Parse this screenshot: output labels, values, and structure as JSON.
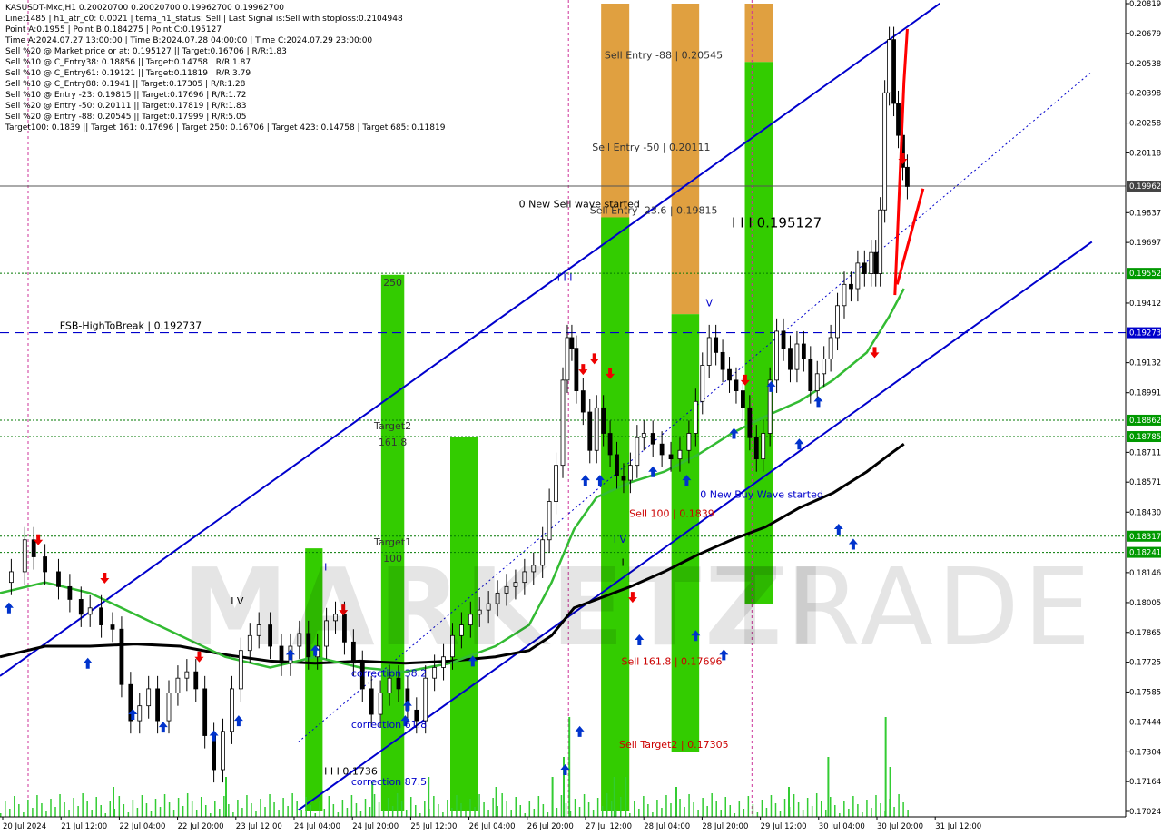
{
  "header": {
    "lines": [
      "KASUSDT-Mxc,H1  0.20020700 0.20020700 0.19962700 0.19962700",
      "Line:1485 | h1_atr_c0: 0.0021 | tema_h1_status: Sell | Last Signal is:Sell with stoploss:0.2104948",
      "Point A:0.1955 | Point B:0.184275 | Point C:0.195127",
      "Time A:2024.07.27 13:00:00 | Time B:2024.07.28 04:00:00 | Time C:2024.07.29 23:00:00",
      "Sell %20 @ Market price or at: 0.195127 || Target:0.16706 | R/R:1.83",
      "Sell %10 @ C_Entry38: 0.18856 || Target:0.14758 | R/R:1.87",
      "Sell %10 @ C_Entry61: 0.19121 || Target:0.11819 | R/R:3.79",
      "Sell %10 @ C_Entry88: 0.1941 || Target:0.17305 | R/R:1.28",
      "Sell %10 @ Entry -23: 0.19815 || Target:0.17696 | R/R:1.72",
      "Sell %20 @ Entry -50: 0.20111 || Target:0.17819 | R/R:1.83",
      "Sell %20 @ Entry -88: 0.20545 || Target:0.17999 | R/R:5.05",
      "Target100: 0.1839 || Target 161: 0.17696 | Target 250: 0.16706 | Target 423: 0.14758 | Target 685: 0.11819"
    ]
  },
  "watermark": {
    "left": "MARKETZI",
    "right": "TRADE"
  },
  "colors": {
    "channel": "#0000cc",
    "green_bar": "#33cc00",
    "orange_bar": "#e0a040",
    "ma_green": "#33bb33",
    "ma_black": "#000000",
    "grid_level": "#007700",
    "red": "#ff0000",
    "price_tag": "#444444"
  },
  "chart_data": {
    "type": "line",
    "symbol": "KASUSDT-Mxc",
    "timeframe": "H1",
    "ylim": [
      0.17024,
      0.20819
    ],
    "y_ticks": [
      "0.20819",
      "0.20679",
      "0.20538",
      "0.20398",
      "0.20258",
      "0.20118",
      "0.19837",
      "0.19697",
      "0.19412",
      "0.19132",
      "0.18991",
      "0.18711",
      "0.18571",
      "0.18430",
      "0.18146",
      "0.18005",
      "0.17865",
      "0.17725",
      "0.17585",
      "0.17444",
      "0.17304",
      "0.17164",
      "0.17024"
    ],
    "x_labels": [
      "20 Jul 2024",
      "21 Jul 12:00",
      "22 Jul 04:00",
      "22 Jul 20:00",
      "23 Jul 12:00",
      "24 Jul 04:00",
      "24 Jul 20:00",
      "25 Jul 12:00",
      "26 Jul 04:00",
      "26 Jul 20:00",
      "27 Jul 12:00",
      "28 Jul 04:00",
      "28 Jul 20:00",
      "29 Jul 12:00",
      "30 Jul 04:00",
      "30 Jul 20:00",
      "31 Jul 12:00"
    ],
    "price_tags": [
      {
        "value": 0.19962,
        "label": "0.19962",
        "kind": "current"
      },
      {
        "value": 0.19552,
        "label": "0.19552",
        "kind": "level"
      },
      {
        "value": 0.19273,
        "label": "0.19273",
        "kind": "fsb"
      },
      {
        "value": 0.18862,
        "label": "0.18862",
        "kind": "level"
      },
      {
        "value": 0.18785,
        "label": "0.18785",
        "kind": "level"
      },
      {
        "value": 0.18317,
        "label": "0.18317",
        "kind": "level"
      },
      {
        "value": 0.18241,
        "label": "0.18241",
        "kind": "level"
      }
    ],
    "bars": [
      {
        "color": "green",
        "x0": 0.3386,
        "x1": 0.3591,
        "top": 0.19545,
        "bottom": 0.17024,
        "label_top": "250",
        "label_mid": "Target2",
        "label_mid2": "161.8",
        "label_low": "Target1",
        "label_low2": "100"
      },
      {
        "color": "green",
        "x0": 0.2711,
        "x1": 0.2866,
        "top": 0.1826,
        "bottom": 0.17024
      },
      {
        "color": "green",
        "x0": 0.4,
        "x1": 0.4246,
        "top": 0.18785,
        "bottom": 0.17024
      },
      {
        "color": "orange",
        "x0": 0.534,
        "x1": 0.559,
        "top": 0.20819,
        "bottom": 0.17024
      },
      {
        "color": "green",
        "x0": 0.534,
        "x1": 0.559,
        "top": 0.19815,
        "bottom": 0.17024
      },
      {
        "color": "orange",
        "x0": 0.5965,
        "x1": 0.6211,
        "top": 0.20819,
        "bottom": 0.1936
      },
      {
        "color": "green",
        "x0": 0.5965,
        "x1": 0.6211,
        "top": 0.1936,
        "bottom": 0.17305
      },
      {
        "color": "orange",
        "x0": 0.6617,
        "x1": 0.6865,
        "top": 0.20819,
        "bottom": 0.20545
      },
      {
        "color": "green",
        "x0": 0.6617,
        "x1": 0.6865,
        "top": 0.20545,
        "bottom": 0.18
      }
    ],
    "labels": [
      {
        "text": "Sell Entry -88 | 0.20545",
        "x": 0.537,
        "y": 0.20545,
        "color": "#333333"
      },
      {
        "text": "Sell Entry -50 | 0.20111",
        "x": 0.526,
        "y": 0.20111,
        "color": "#333333"
      },
      {
        "text": "Sell Entry -23.6 | 0.19815",
        "x": 0.524,
        "y": 0.19815,
        "color": "#333333"
      },
      {
        "text": "0 New Sell wave started",
        "x": 0.461,
        "y": 0.19815,
        "color": "#000000",
        "dy": -7
      },
      {
        "text": "I I I 0.195127",
        "x": 0.65,
        "y": 0.1975,
        "color": "#000000"
      },
      {
        "text": "FSB-HighToBreak | 0.192737",
        "x": 0.053,
        "y": 0.19273,
        "color": "#000000"
      },
      {
        "text": "Sell 100 | 0.1839",
        "x": 0.559,
        "y": 0.1839,
        "color": "#cc0000"
      },
      {
        "text": "0 New Buy Wave started",
        "x": 0.622,
        "y": 0.1848,
        "color": "#0000cc"
      },
      {
        "text": "Sell 161.8 | 0.17696",
        "x": 0.552,
        "y": 0.17696,
        "color": "#cc0000"
      },
      {
        "text": "Sell Target2 | 0.17305",
        "x": 0.55,
        "y": 0.17305,
        "color": "#cc0000"
      },
      {
        "text": "correction 38.2",
        "x": 0.312,
        "y": 0.1764,
        "color": "#0000cc"
      },
      {
        "text": "correction 61.8",
        "x": 0.312,
        "y": 0.174,
        "color": "#0000cc"
      },
      {
        "text": "correction 87.5",
        "x": 0.312,
        "y": 0.1713,
        "color": "#0000cc"
      },
      {
        "text": "I I I 0.1736",
        "x": 0.288,
        "y": 0.1718,
        "color": "#000000"
      },
      {
        "text": "I I I",
        "x": 0.495,
        "y": 0.195,
        "color": "#0000cc"
      },
      {
        "text": "V",
        "x": 0.627,
        "y": 0.1938,
        "color": "#0000cc"
      },
      {
        "text": "I V",
        "x": 0.205,
        "y": 0.1798,
        "color": "#000000"
      },
      {
        "text": "I V",
        "x": 0.545,
        "y": 0.1827,
        "color": "#0000cc"
      },
      {
        "text": "I",
        "x": 0.288,
        "y": 0.1814,
        "color": "#0000cc"
      },
      {
        "text": "I",
        "x": 0.552,
        "y": 0.1816,
        "color": "#000000"
      }
    ],
    "price_series": [
      [
        0.0,
        0.181
      ],
      [
        0.01,
        0.1815
      ],
      [
        0.022,
        0.183
      ],
      [
        0.03,
        0.1822
      ],
      [
        0.04,
        0.1815
      ],
      [
        0.052,
        0.1808
      ],
      [
        0.062,
        0.1802
      ],
      [
        0.072,
        0.1795
      ],
      [
        0.08,
        0.1798
      ],
      [
        0.09,
        0.179
      ],
      [
        0.1,
        0.1788
      ],
      [
        0.108,
        0.1762
      ],
      [
        0.116,
        0.1745
      ],
      [
        0.124,
        0.1752
      ],
      [
        0.132,
        0.176
      ],
      [
        0.14,
        0.1745
      ],
      [
        0.15,
        0.1758
      ],
      [
        0.158,
        0.1765
      ],
      [
        0.166,
        0.1768
      ],
      [
        0.174,
        0.176
      ],
      [
        0.182,
        0.1738
      ],
      [
        0.19,
        0.1722
      ],
      [
        0.198,
        0.174
      ],
      [
        0.206,
        0.176
      ],
      [
        0.214,
        0.1778
      ],
      [
        0.222,
        0.1785
      ],
      [
        0.23,
        0.179
      ],
      [
        0.24,
        0.178
      ],
      [
        0.25,
        0.1772
      ],
      [
        0.258,
        0.178
      ],
      [
        0.266,
        0.1786
      ],
      [
        0.274,
        0.1775
      ],
      [
        0.282,
        0.178
      ],
      [
        0.29,
        0.1792
      ],
      [
        0.298,
        0.1795
      ],
      [
        0.306,
        0.1782
      ],
      [
        0.314,
        0.1772
      ],
      [
        0.322,
        0.176
      ],
      [
        0.33,
        0.1748
      ],
      [
        0.338,
        0.1758
      ],
      [
        0.346,
        0.1765
      ],
      [
        0.354,
        0.176
      ],
      [
        0.362,
        0.175
      ],
      [
        0.37,
        0.1745
      ],
      [
        0.378,
        0.1765
      ],
      [
        0.386,
        0.177
      ],
      [
        0.394,
        0.1775
      ],
      [
        0.402,
        0.1785
      ],
      [
        0.41,
        0.179
      ],
      [
        0.418,
        0.1795
      ],
      [
        0.426,
        0.1797
      ],
      [
        0.434,
        0.18
      ],
      [
        0.442,
        0.1805
      ],
      [
        0.45,
        0.1808
      ],
      [
        0.458,
        0.181
      ],
      [
        0.466,
        0.1815
      ],
      [
        0.474,
        0.1818
      ],
      [
        0.482,
        0.183
      ],
      [
        0.488,
        0.1848
      ],
      [
        0.494,
        0.1865
      ],
      [
        0.5,
        0.1905
      ],
      [
        0.504,
        0.1925
      ],
      [
        0.508,
        0.192
      ],
      [
        0.512,
        0.19
      ],
      [
        0.518,
        0.189
      ],
      [
        0.524,
        0.1872
      ],
      [
        0.53,
        0.1892
      ],
      [
        0.536,
        0.188
      ],
      [
        0.542,
        0.187
      ],
      [
        0.548,
        0.186
      ],
      [
        0.554,
        0.1858
      ],
      [
        0.56,
        0.1865
      ],
      [
        0.566,
        0.1878
      ],
      [
        0.572,
        0.188
      ],
      [
        0.58,
        0.1875
      ],
      [
        0.588,
        0.187
      ],
      [
        0.596,
        0.1868
      ],
      [
        0.604,
        0.1872
      ],
      [
        0.612,
        0.188
      ],
      [
        0.618,
        0.1895
      ],
      [
        0.624,
        0.1912
      ],
      [
        0.63,
        0.1925
      ],
      [
        0.636,
        0.1918
      ],
      [
        0.642,
        0.191
      ],
      [
        0.648,
        0.1905
      ],
      [
        0.654,
        0.19
      ],
      [
        0.66,
        0.1892
      ],
      [
        0.666,
        0.1878
      ],
      [
        0.672,
        0.1868
      ],
      [
        0.678,
        0.188
      ],
      [
        0.684,
        0.1905
      ],
      [
        0.69,
        0.1928
      ],
      [
        0.696,
        0.192
      ],
      [
        0.702,
        0.191
      ],
      [
        0.708,
        0.1922
      ],
      [
        0.714,
        0.1915
      ],
      [
        0.72,
        0.19
      ],
      [
        0.726,
        0.1908
      ],
      [
        0.732,
        0.1915
      ],
      [
        0.738,
        0.1925
      ],
      [
        0.744,
        0.194
      ],
      [
        0.75,
        0.195
      ],
      [
        0.756,
        0.1948
      ],
      [
        0.762,
        0.196
      ],
      [
        0.768,
        0.1955
      ],
      [
        0.774,
        0.1965
      ],
      [
        0.778,
        0.1955
      ],
      [
        0.782,
        0.1985
      ],
      [
        0.786,
        0.204
      ],
      [
        0.79,
        0.2065
      ],
      [
        0.794,
        0.2035
      ],
      [
        0.798,
        0.202
      ],
      [
        0.802,
        0.2005
      ],
      [
        0.806,
        0.1996
      ]
    ],
    "ma_green": [
      [
        0.0,
        0.1805
      ],
      [
        0.04,
        0.181
      ],
      [
        0.08,
        0.1805
      ],
      [
        0.12,
        0.1795
      ],
      [
        0.16,
        0.1785
      ],
      [
        0.2,
        0.1775
      ],
      [
        0.24,
        0.177
      ],
      [
        0.28,
        0.1775
      ],
      [
        0.32,
        0.177
      ],
      [
        0.36,
        0.1768
      ],
      [
        0.4,
        0.1772
      ],
      [
        0.44,
        0.178
      ],
      [
        0.47,
        0.179
      ],
      [
        0.49,
        0.181
      ],
      [
        0.51,
        0.1835
      ],
      [
        0.53,
        0.185
      ],
      [
        0.56,
        0.1857
      ],
      [
        0.59,
        0.1862
      ],
      [
        0.62,
        0.187
      ],
      [
        0.65,
        0.188
      ],
      [
        0.68,
        0.1888
      ],
      [
        0.71,
        0.1895
      ],
      [
        0.74,
        0.1905
      ],
      [
        0.77,
        0.1918
      ],
      [
        0.79,
        0.1935
      ],
      [
        0.803,
        0.1948
      ]
    ],
    "ma_black": [
      [
        0.0,
        0.1775
      ],
      [
        0.04,
        0.178
      ],
      [
        0.08,
        0.178
      ],
      [
        0.12,
        0.1781
      ],
      [
        0.16,
        0.178
      ],
      [
        0.2,
        0.1776
      ],
      [
        0.24,
        0.1773
      ],
      [
        0.28,
        0.1772
      ],
      [
        0.32,
        0.1773
      ],
      [
        0.36,
        0.1772
      ],
      [
        0.4,
        0.1773
      ],
      [
        0.44,
        0.1775
      ],
      [
        0.47,
        0.1778
      ],
      [
        0.49,
        0.1785
      ],
      [
        0.51,
        0.1798
      ],
      [
        0.53,
        0.1802
      ],
      [
        0.56,
        0.1808
      ],
      [
        0.59,
        0.1815
      ],
      [
        0.62,
        0.1823
      ],
      [
        0.65,
        0.183
      ],
      [
        0.68,
        0.1836
      ],
      [
        0.71,
        0.1845
      ],
      [
        0.74,
        0.1852
      ],
      [
        0.77,
        0.1862
      ],
      [
        0.79,
        0.187
      ],
      [
        0.803,
        0.1875
      ]
    ],
    "channel_lines": [
      {
        "p1": [
          0.0,
          0.1766
        ],
        "p2": [
          0.835,
          0.2082
        ],
        "style": "solid"
      },
      {
        "p1": [
          0.265,
          0.1703
        ],
        "p2": [
          0.97,
          0.197
        ],
        "style": "solid"
      },
      {
        "p1": [
          0.265,
          0.1735
        ],
        "p2": [
          0.97,
          0.205
        ],
        "style": "dotted"
      }
    ],
    "h_levels": [
      {
        "value": 0.19962,
        "style": "solid",
        "color": "#555555"
      },
      {
        "value": 0.19552,
        "style": "dotted",
        "color": "#007700"
      },
      {
        "value": 0.19273,
        "style": "dashed",
        "color": "#0000cc"
      },
      {
        "value": 0.18862,
        "style": "dotted",
        "color": "#007700"
      },
      {
        "value": 0.18785,
        "style": "dotted",
        "color": "#007700"
      },
      {
        "value": 0.18317,
        "style": "dotted",
        "color": "#007700"
      },
      {
        "value": 0.18241,
        "style": "dotted",
        "color": "#007700"
      }
    ],
    "v_markers": [
      0.025,
      0.505,
      0.668
    ],
    "buy_arrows": [
      [
        0.008,
        0.1798
      ],
      [
        0.078,
        0.1772
      ],
      [
        0.118,
        0.1748
      ],
      [
        0.145,
        0.1742
      ],
      [
        0.19,
        0.1738
      ],
      [
        0.212,
        0.1745
      ],
      [
        0.258,
        0.1776
      ],
      [
        0.28,
        0.1778
      ],
      [
        0.36,
        0.1745
      ],
      [
        0.362,
        0.1752
      ],
      [
        0.42,
        0.1773
      ],
      [
        0.515,
        0.174
      ],
      [
        0.502,
        0.1722
      ],
      [
        0.52,
        0.1858
      ],
      [
        0.533,
        0.1858
      ],
      [
        0.568,
        0.1783
      ],
      [
        0.58,
        0.1862
      ],
      [
        0.61,
        0.1858
      ],
      [
        0.618,
        0.1785
      ],
      [
        0.643,
        0.1776
      ],
      [
        0.652,
        0.188
      ],
      [
        0.685,
        0.1902
      ],
      [
        0.71,
        0.1875
      ],
      [
        0.727,
        0.1895
      ],
      [
        0.745,
        0.1835
      ],
      [
        0.758,
        0.1828
      ]
    ],
    "sell_arrows": [
      [
        0.034,
        0.183
      ],
      [
        0.093,
        0.1812
      ],
      [
        0.177,
        0.1775
      ],
      [
        0.305,
        0.1797
      ],
      [
        0.518,
        0.191
      ],
      [
        0.528,
        0.1915
      ],
      [
        0.542,
        0.1908
      ],
      [
        0.562,
        0.1803
      ],
      [
        0.662,
        0.1905
      ],
      [
        0.777,
        0.1918
      ],
      [
        0.802,
        0.2009
      ]
    ],
    "volume": [
      [
        0.49,
        0.4
      ],
      [
        0.5,
        0.6
      ],
      [
        0.505,
        1.0
      ],
      [
        0.545,
        0.4
      ],
      [
        0.555,
        0.4
      ],
      [
        0.6,
        0.3
      ],
      [
        0.7,
        0.3
      ],
      [
        0.735,
        0.6
      ],
      [
        0.786,
        1.0
      ],
      [
        0.79,
        0.5
      ],
      [
        0.1,
        0.3
      ],
      [
        0.2,
        0.4
      ],
      [
        0.33,
        0.35
      ],
      [
        0.38,
        0.4
      ],
      [
        0.44,
        0.3
      ]
    ]
  }
}
